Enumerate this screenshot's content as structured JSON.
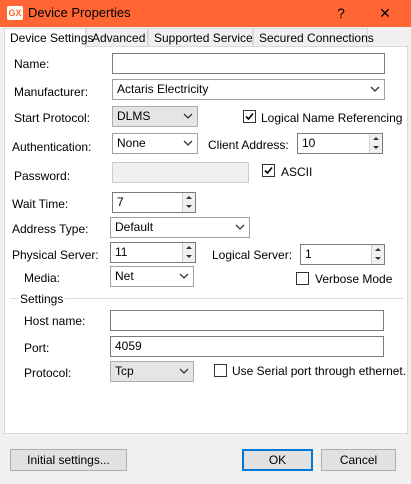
{
  "window": {
    "title": "Device Properties",
    "help_glyph": "?",
    "close_glyph": "✕",
    "accent_color": "#ff6633"
  },
  "tabs": [
    {
      "label": "Device Settings",
      "active": true
    },
    {
      "label": "Advanced",
      "active": false
    },
    {
      "label": "Supported Services",
      "active": false
    },
    {
      "label": "Secured Connections",
      "active": false
    }
  ],
  "form": {
    "name": {
      "label": "Name:",
      "value": ""
    },
    "manufacturer": {
      "label": "Manufacturer:",
      "value": "Actaris Electricity"
    },
    "start_protocol": {
      "label": "Start Protocol:",
      "value": "DLMS"
    },
    "logical_name_referencing": {
      "label": "Logical Name Referencing",
      "checked": true
    },
    "authentication": {
      "label": "Authentication:",
      "value": "None"
    },
    "client_address": {
      "label": "Client Address:",
      "value": "10"
    },
    "password": {
      "label": "Password:",
      "value": ""
    },
    "ascii": {
      "label": "ASCII",
      "checked": true
    },
    "wait_time": {
      "label": "Wait Time:",
      "value": "7"
    },
    "address_type": {
      "label": "Address Type:",
      "value": "Default"
    },
    "physical_server": {
      "label": "Physical Server:",
      "value": "11"
    },
    "logical_server": {
      "label": "Logical Server:",
      "value": "1"
    },
    "media": {
      "label": "Media:",
      "value": "Net"
    },
    "verbose_mode": {
      "label": "Verbose Mode",
      "checked": false
    }
  },
  "settings": {
    "group_label": "Settings",
    "host_name": {
      "label": "Host name:",
      "value": ""
    },
    "port": {
      "label": "Port:",
      "value": "4059"
    },
    "protocol": {
      "label": "Protocol:",
      "value": "Tcp"
    },
    "use_serial": {
      "label": "Use Serial port through ethernet.",
      "checked": false
    }
  },
  "buttons": {
    "initial_settings": "Initial settings...",
    "ok": "OK",
    "cancel": "Cancel"
  }
}
